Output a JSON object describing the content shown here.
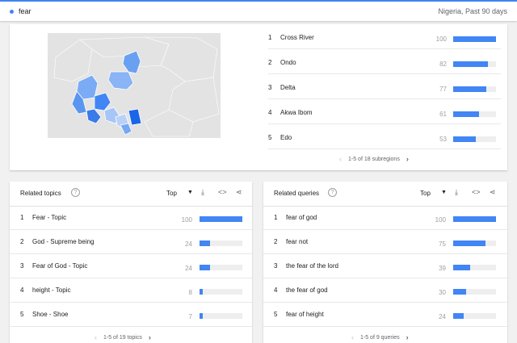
{
  "header": {
    "term": "fear",
    "filter": "Nigeria, Past 90 days",
    "term_color": "#4285f4"
  },
  "subregions": {
    "rows": [
      {
        "rank": "1",
        "name": "Cross River",
        "value": 100
      },
      {
        "rank": "2",
        "name": "Ondo",
        "value": 82
      },
      {
        "rank": "3",
        "name": "Delta",
        "value": 77
      },
      {
        "rank": "4",
        "name": "Akwa Ibom",
        "value": 61
      },
      {
        "rank": "5",
        "name": "Edo",
        "value": 53
      }
    ],
    "pager": "1-5 of 18 subregions"
  },
  "related_topics": {
    "title": "Related topics",
    "selector": "Top",
    "rows": [
      {
        "rank": "1",
        "name": "Fear - Topic",
        "value": 100
      },
      {
        "rank": "2",
        "name": "God - Supreme being",
        "value": 24
      },
      {
        "rank": "3",
        "name": "Fear of God - Topic",
        "value": 24
      },
      {
        "rank": "4",
        "name": "height - Topic",
        "value": 8
      },
      {
        "rank": "5",
        "name": "Shoe - Shoe",
        "value": 7
      }
    ],
    "pager": "1-5 of 19 topics"
  },
  "related_queries": {
    "title": "Related queries",
    "selector": "Top",
    "rows": [
      {
        "rank": "1",
        "name": "fear of god",
        "value": 100
      },
      {
        "rank": "2",
        "name": "fear not",
        "value": 75
      },
      {
        "rank": "3",
        "name": "the fear of the lord",
        "value": 39
      },
      {
        "rank": "4",
        "name": "the fear of god",
        "value": 30
      },
      {
        "rank": "5",
        "name": "fear of height",
        "value": 24
      }
    ],
    "pager": "1-5 of 9 queries"
  },
  "colors": {
    "accent": "#4285f4",
    "bar_track": "#eeeeee"
  },
  "icons": {
    "help": "help-circle-icon",
    "download": "download-icon",
    "embed": "embed-code-icon",
    "share": "share-icon"
  }
}
